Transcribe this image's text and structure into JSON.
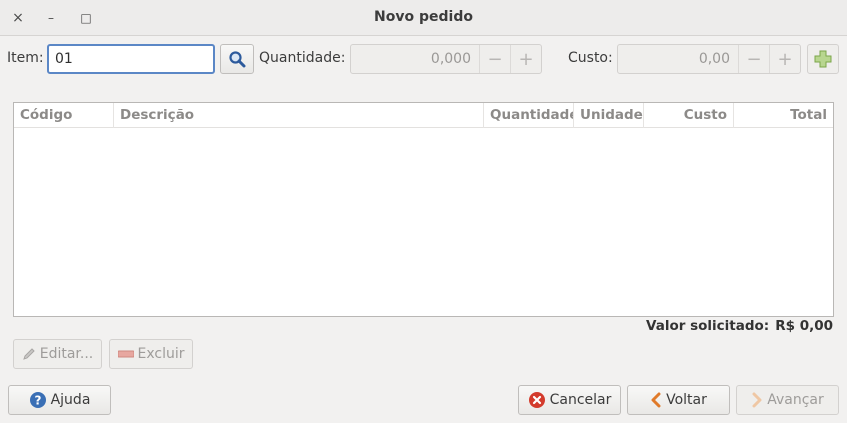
{
  "window": {
    "title": "Novo pedido",
    "close_glyph": "×",
    "minimize_glyph": "–",
    "maximize_glyph": "□"
  },
  "form": {
    "item_label": "Item:",
    "item_value": "01",
    "quantity_label": "Quantidade:",
    "quantity_value": "0,000",
    "cost_label": "Custo:",
    "cost_value": "0,00",
    "minus": "−",
    "plus": "+"
  },
  "table": {
    "columns": [
      "Código",
      "Descrição",
      "Quantidade",
      "Unidade",
      "Custo",
      "Total"
    ]
  },
  "summary": {
    "label": "Valor solicitado:",
    "value": "R$ 0,00"
  },
  "actions": {
    "edit_label": "Editar...",
    "delete_label": "Excluir"
  },
  "footer": {
    "help_label": "Ajuda",
    "cancel_label": "Cancelar",
    "back_label": "Voltar",
    "next_label": "Avançar"
  },
  "icons": {
    "search": "search-icon",
    "add": "plus-icon",
    "help": "help-icon",
    "cancel": "cancel-icon",
    "back": "chevron-left-icon",
    "next": "chevron-right-icon",
    "edit": "pencil-icon",
    "delete": "remove-icon"
  },
  "colors": {
    "focus": "#5b87c6",
    "cancel_red": "#d33b2c",
    "back_orange": "#e07a2a",
    "add_green": "#8ec05a"
  }
}
